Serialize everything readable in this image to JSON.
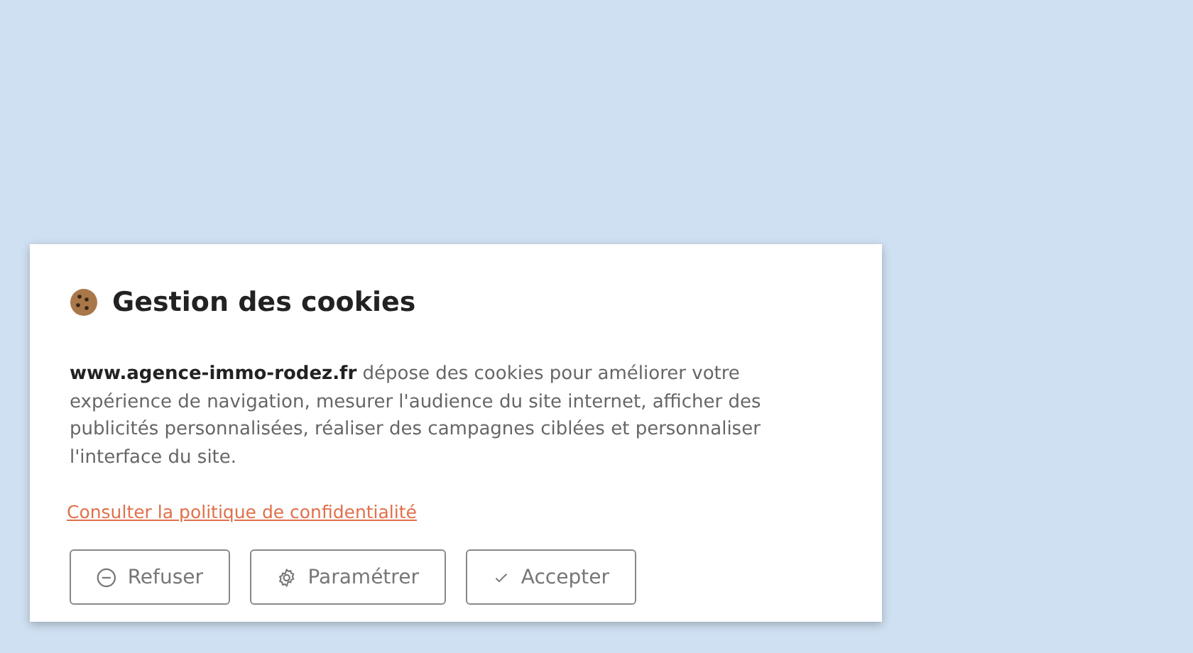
{
  "dialog": {
    "title": "Gestion des cookies",
    "message": "**www.agence-immo-rodez.fr** dépose des cookies pour améliorer votre expérience de navigation, mesurer l'audience du site internet, afficher des publicités personnalisées, réaliser des campagnes ciblées et personnaliser l'interface du site.",
    "privacy_link": "Consulter la politique de confidentialité",
    "buttons": [
      {
        "kind": "refuse",
        "label": "Refuser"
      },
      {
        "kind": "settings",
        "label": "Paramétrer"
      },
      {
        "kind": "accept",
        "label": "Accepter"
      }
    ]
  }
}
